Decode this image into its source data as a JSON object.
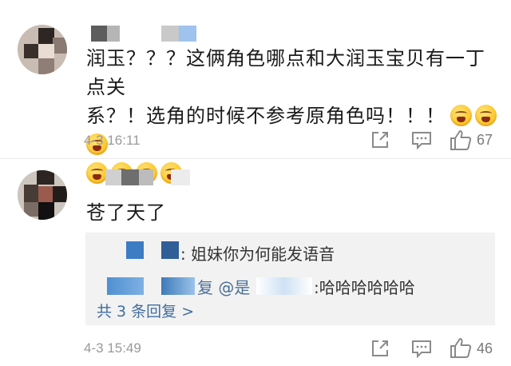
{
  "comments": [
    {
      "text_line1": "润玉？？？这俩角色哪点和大润玉宝贝有一丁点关",
      "text_line2": "系？！选角的时候不参考原角色吗！！！",
      "emoji_name": "angry-face-emoji",
      "time": "4-3 16:11",
      "like_count": "67"
    },
    {
      "text_line1": "苍了天了",
      "time": "4-3 15:49",
      "like_count": "46",
      "replies": {
        "reply1_text": ": 姐妹你为何能发语音",
        "reply2_prefix": "复 @是",
        "reply2_text": ":哈哈哈哈哈哈",
        "more_label": "共 3 条回复 >"
      }
    }
  ],
  "icons": {
    "share": "share-icon",
    "comment": "comment-icon",
    "like": "thumbs-up-icon"
  },
  "colors": {
    "link_blue": "#3f6e9e",
    "meta_gray": "#9a9a9a",
    "reply_bg": "#f2f2f2"
  }
}
